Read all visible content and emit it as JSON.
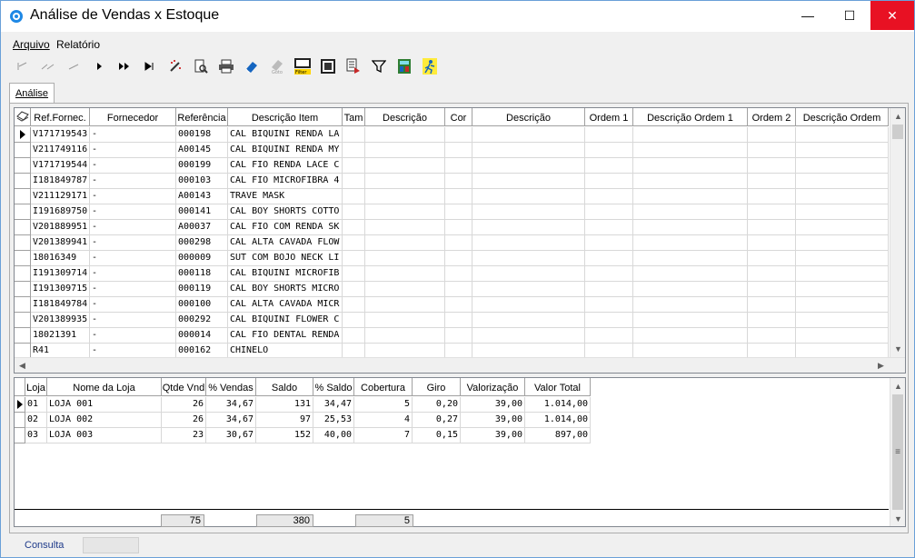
{
  "window": {
    "title": "Análise de Vendas x Estoque",
    "minimize": "—",
    "maximize": "☐",
    "close": "✕"
  },
  "menu": {
    "items": [
      "Arquivo",
      "Relatório"
    ]
  },
  "tabs": [
    {
      "label": "Análise"
    }
  ],
  "top_grid": {
    "columns": [
      "Ref.Fornec.",
      "Fornecedor",
      "Referência",
      "Descrição Item",
      "Tam",
      "Descrição",
      "Cor",
      "Descrição",
      "Ordem 1",
      "Descrição Ordem 1",
      "Ordem 2",
      "Descrição Ordem"
    ],
    "rows": [
      [
        "V171719543",
        "-",
        "000198",
        "CAL BIQUINI RENDA LA"
      ],
      [
        "V211749116",
        "-",
        "A00145",
        "CAL BIQUINI RENDA MY"
      ],
      [
        "V171719544",
        "-",
        "000199",
        "CAL FIO RENDA LACE C"
      ],
      [
        "I181849787",
        "-",
        "000103",
        "CAL FIO MICROFIBRA 4"
      ],
      [
        "V211129171",
        "-",
        "A00143",
        "TRAVE MASK"
      ],
      [
        "I191689750",
        "-",
        "000141",
        "CAL BOY SHORTS COTTO"
      ],
      [
        "V201889951",
        "-",
        "A00037",
        "CAL FIO COM RENDA SK"
      ],
      [
        "V201389941",
        "-",
        "000298",
        "CAL ALTA CAVADA FLOW"
      ],
      [
        "18016349",
        "-",
        "000009",
        "SUT COM BOJO NECK LI"
      ],
      [
        "I191309714",
        "-",
        "000118",
        "CAL BIQUINI MICROFIB"
      ],
      [
        "I191309715",
        "-",
        "000119",
        "CAL BOY SHORTS MICRO"
      ],
      [
        "I181849784",
        "-",
        "000100",
        "CAL ALTA CAVADA MICR"
      ],
      [
        "V201389935",
        "-",
        "000292",
        "CAL BIQUINI FLOWER C"
      ],
      [
        "18021391",
        "-",
        "000014",
        "CAL FIO DENTAL RENDA"
      ],
      [
        "R41",
        "-",
        "000162",
        "CHINELO"
      ]
    ]
  },
  "bottom_grid": {
    "columns": [
      "Loja",
      "Nome da Loja",
      "Qtde Vnd",
      "% Vendas",
      "Saldo",
      "% Saldo",
      "Cobertura",
      "Giro",
      "Valorização",
      "Valor Total"
    ],
    "rows": [
      [
        "01",
        "LOJA 001",
        "26",
        "34,67",
        "131",
        "34,47",
        "5",
        "0,20",
        "39,00",
        "1.014,00"
      ],
      [
        "02",
        "LOJA 002",
        "26",
        "34,67",
        "97",
        "25,53",
        "4",
        "0,27",
        "39,00",
        "1.014,00"
      ],
      [
        "03",
        "LOJA 003",
        "23",
        "30,67",
        "152",
        "40,00",
        "7",
        "0,15",
        "39,00",
        "897,00"
      ]
    ],
    "totals": {
      "qtde_vnd": "75",
      "saldo": "380",
      "cobertura": "5"
    }
  },
  "status": {
    "mode": "Consulta"
  },
  "colors": {
    "accent": "#0078d7",
    "close": "#e81123"
  }
}
